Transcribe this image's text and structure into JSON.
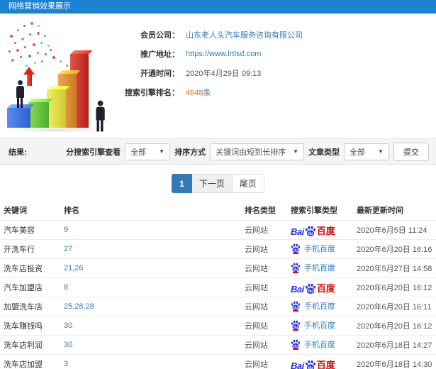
{
  "colors": {
    "header_bg": "#1c82d2",
    "link": "#337ab7",
    "accent_orange": "#ff6600",
    "baidu_blue": "#2932e1",
    "baidu_red": "#e10601"
  },
  "header": {
    "title": "网络营销效果展示"
  },
  "info": {
    "company_label": "会员公司：",
    "company_value": "山东老人头汽车服务咨询有限公司",
    "url_label": "推广地址：",
    "url_value": "https://www.lrtlsd.com",
    "open_label": "开通时间：",
    "open_value": "2020年4月29日 09:13",
    "rank_label": "搜索引擎排名：",
    "rank_count": "4648",
    "rank_unit": "条"
  },
  "filters": {
    "result_label": "结果:",
    "engine_view_label": "分搜索引擎查看",
    "engine_view_value": "全部",
    "sort_label": "排序方式",
    "sort_value": "关键词由短到长排序",
    "article_label": "文章类型",
    "article_value": "全部",
    "submit_label": "提交"
  },
  "pagination": {
    "current": "1",
    "next": "下一页",
    "last": "尾页"
  },
  "engine_logos": {
    "baidu_latin": "Bai",
    "baidu_paw_text": "du",
    "baidu_cn": "百度",
    "mobile_label": "手机百度"
  },
  "table": {
    "headers": [
      "关键词",
      "排名",
      "排名类型",
      "搜索引擎类型",
      "最新更新时间"
    ],
    "rows": [
      {
        "keyword": "汽车美容",
        "rank": "9",
        "rank_type": "云网站",
        "engine": "baidu",
        "time": "2020年6月5日 11:24"
      },
      {
        "keyword": "开洗车行",
        "rank": "27",
        "rank_type": "云网站",
        "engine": "mobile-baidu",
        "time": "2020年6月20日 16:16"
      },
      {
        "keyword": "洗车店投资",
        "rank": "21,26",
        "rank_type": "云网站",
        "engine": "mobile-baidu",
        "time": "2020年5月27日 14:58"
      },
      {
        "keyword": "汽车加盟店",
        "rank": "8",
        "rank_type": "云网站",
        "engine": "baidu",
        "time": "2020年6月20日 16:12"
      },
      {
        "keyword": "加盟洗车店",
        "rank": "25,28,28",
        "rank_type": "云网站",
        "engine": "mobile-baidu",
        "time": "2020年6月20日 16:11"
      },
      {
        "keyword": "洗车赚钱吗",
        "rank": "30",
        "rank_type": "云网站",
        "engine": "mobile-baidu",
        "time": "2020年6月20日 16:12"
      },
      {
        "keyword": "洗车店利润",
        "rank": "30",
        "rank_type": "云网站",
        "engine": "mobile-baidu",
        "time": "2020年6月18日 14:27"
      },
      {
        "keyword": "洗车店加盟",
        "rank": "3",
        "rank_type": "云网站",
        "engine": "baidu",
        "time": "2020年6月18日 14:30"
      }
    ]
  }
}
